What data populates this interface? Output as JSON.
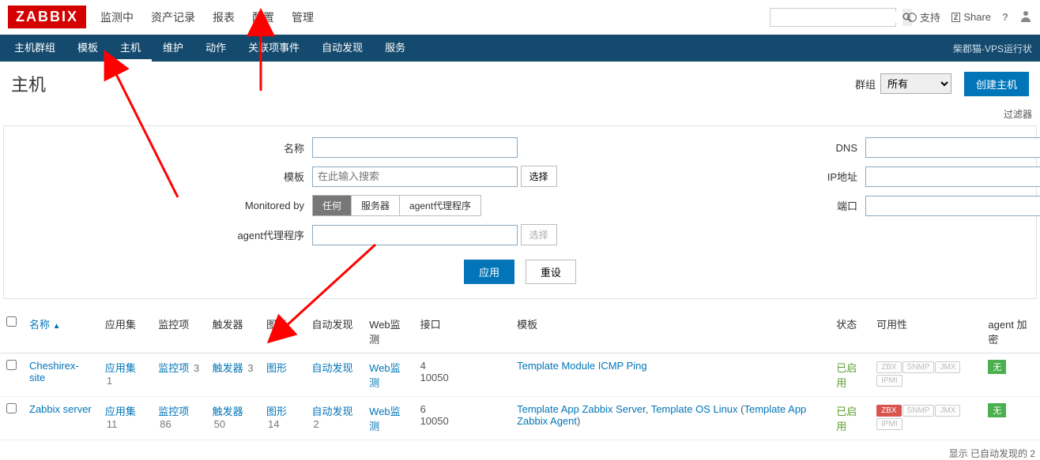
{
  "brand": "ZABBIX",
  "topnav": [
    "监测中",
    "资产记录",
    "报表",
    "配置",
    "管理"
  ],
  "support": "支持",
  "share": "Share",
  "subnav": {
    "items": [
      "主机群组",
      "模板",
      "主机",
      "维护",
      "动作",
      "关联项事件",
      "自动发现",
      "服务"
    ],
    "active": 2,
    "right": "柴郡猫-VPS运行状"
  },
  "page": {
    "title": "主机",
    "group_label": "群组",
    "group_value": "所有",
    "create_btn": "创建主机",
    "filter_toggle": "过滤器"
  },
  "filter": {
    "labels": {
      "name": "名称",
      "template": "模板",
      "template_ph": "在此输入搜索",
      "select": "选择",
      "monitored_by": "Monitored by",
      "agent_proxy": "agent代理程序",
      "dns": "DNS",
      "ip": "IP地址",
      "port": "端口"
    },
    "monitored_by_opts": [
      "任何",
      "服务器",
      "agent代理程序"
    ],
    "monitored_by_sel": 0,
    "apply": "应用",
    "reset": "重设"
  },
  "table": {
    "headers": {
      "name": "名称",
      "apps": "应用集",
      "items": "监控项",
      "triggers": "触发器",
      "graphs": "图形",
      "discovery": "自动发现",
      "web": "Web监测",
      "iface": "接口",
      "template": "模板",
      "status": "状态",
      "avail": "可用性",
      "encrypt": "agent 加密"
    },
    "rows": [
      {
        "name": "Cheshirex-site",
        "apps": {
          "label": "应用集",
          "n": 1
        },
        "items": {
          "label": "监控项",
          "n": 3
        },
        "triggers": {
          "label": "触发器",
          "n": 3
        },
        "graphs": {
          "label": "图形",
          "n": ""
        },
        "discovery": {
          "label": "自动发现",
          "n": ""
        },
        "web": {
          "label": "Web监测",
          "n": ""
        },
        "iface_prefix": "4",
        "iface_suffix": "10050",
        "templates": [
          {
            "text": "Template Module ICMP Ping",
            "link": true
          }
        ],
        "status": "已启用",
        "avail": [
          "ZBX",
          "SNMP",
          "JMX",
          "IPMI"
        ],
        "avail_red": -1,
        "encrypt": "无"
      },
      {
        "name": "Zabbix server",
        "apps": {
          "label": "应用集",
          "n": 11
        },
        "items": {
          "label": "监控项",
          "n": 86
        },
        "triggers": {
          "label": "触发器",
          "n": 50
        },
        "graphs": {
          "label": "图形",
          "n": 14
        },
        "discovery": {
          "label": "自动发现",
          "n": 2
        },
        "web": {
          "label": "Web监测",
          "n": ""
        },
        "iface_prefix": "6",
        "iface_suffix": "10050",
        "templates": [
          {
            "text": "Template App Zabbix Server",
            "link": true
          },
          {
            "text": ", ",
            "link": false
          },
          {
            "text": "Template OS Linux",
            "link": true
          },
          {
            "text": " (",
            "link": false
          },
          {
            "text": "Template App Zabbix Agent",
            "link": true
          },
          {
            "text": ")",
            "link": false
          }
        ],
        "status": "已启用",
        "avail": [
          "ZBX",
          "SNMP",
          "JMX",
          "IPMI"
        ],
        "avail_red": 0,
        "encrypt": "无"
      }
    ],
    "footer": "显示 已自动发现的 2"
  }
}
